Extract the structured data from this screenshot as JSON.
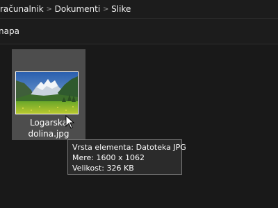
{
  "breadcrumb": {
    "items": [
      "računalnik",
      "Dokumenti",
      "Slike"
    ],
    "separator": ">"
  },
  "toolbar": {
    "label": "napa"
  },
  "file": {
    "name_line1": "Logarska",
    "name_line2": "dolina.jpg",
    "thumbnail": "mountain-valley-photo"
  },
  "tooltip": {
    "type_line": "Vrsta elementa: Datoteka JPG",
    "dimensions_line": "Mere: 1600 x 1062",
    "size_line": "Velikost: 326 KB"
  },
  "colors": {
    "background": "#191919",
    "selection": "#4d4d4d",
    "tooltip_bg": "#2b2b2b"
  }
}
